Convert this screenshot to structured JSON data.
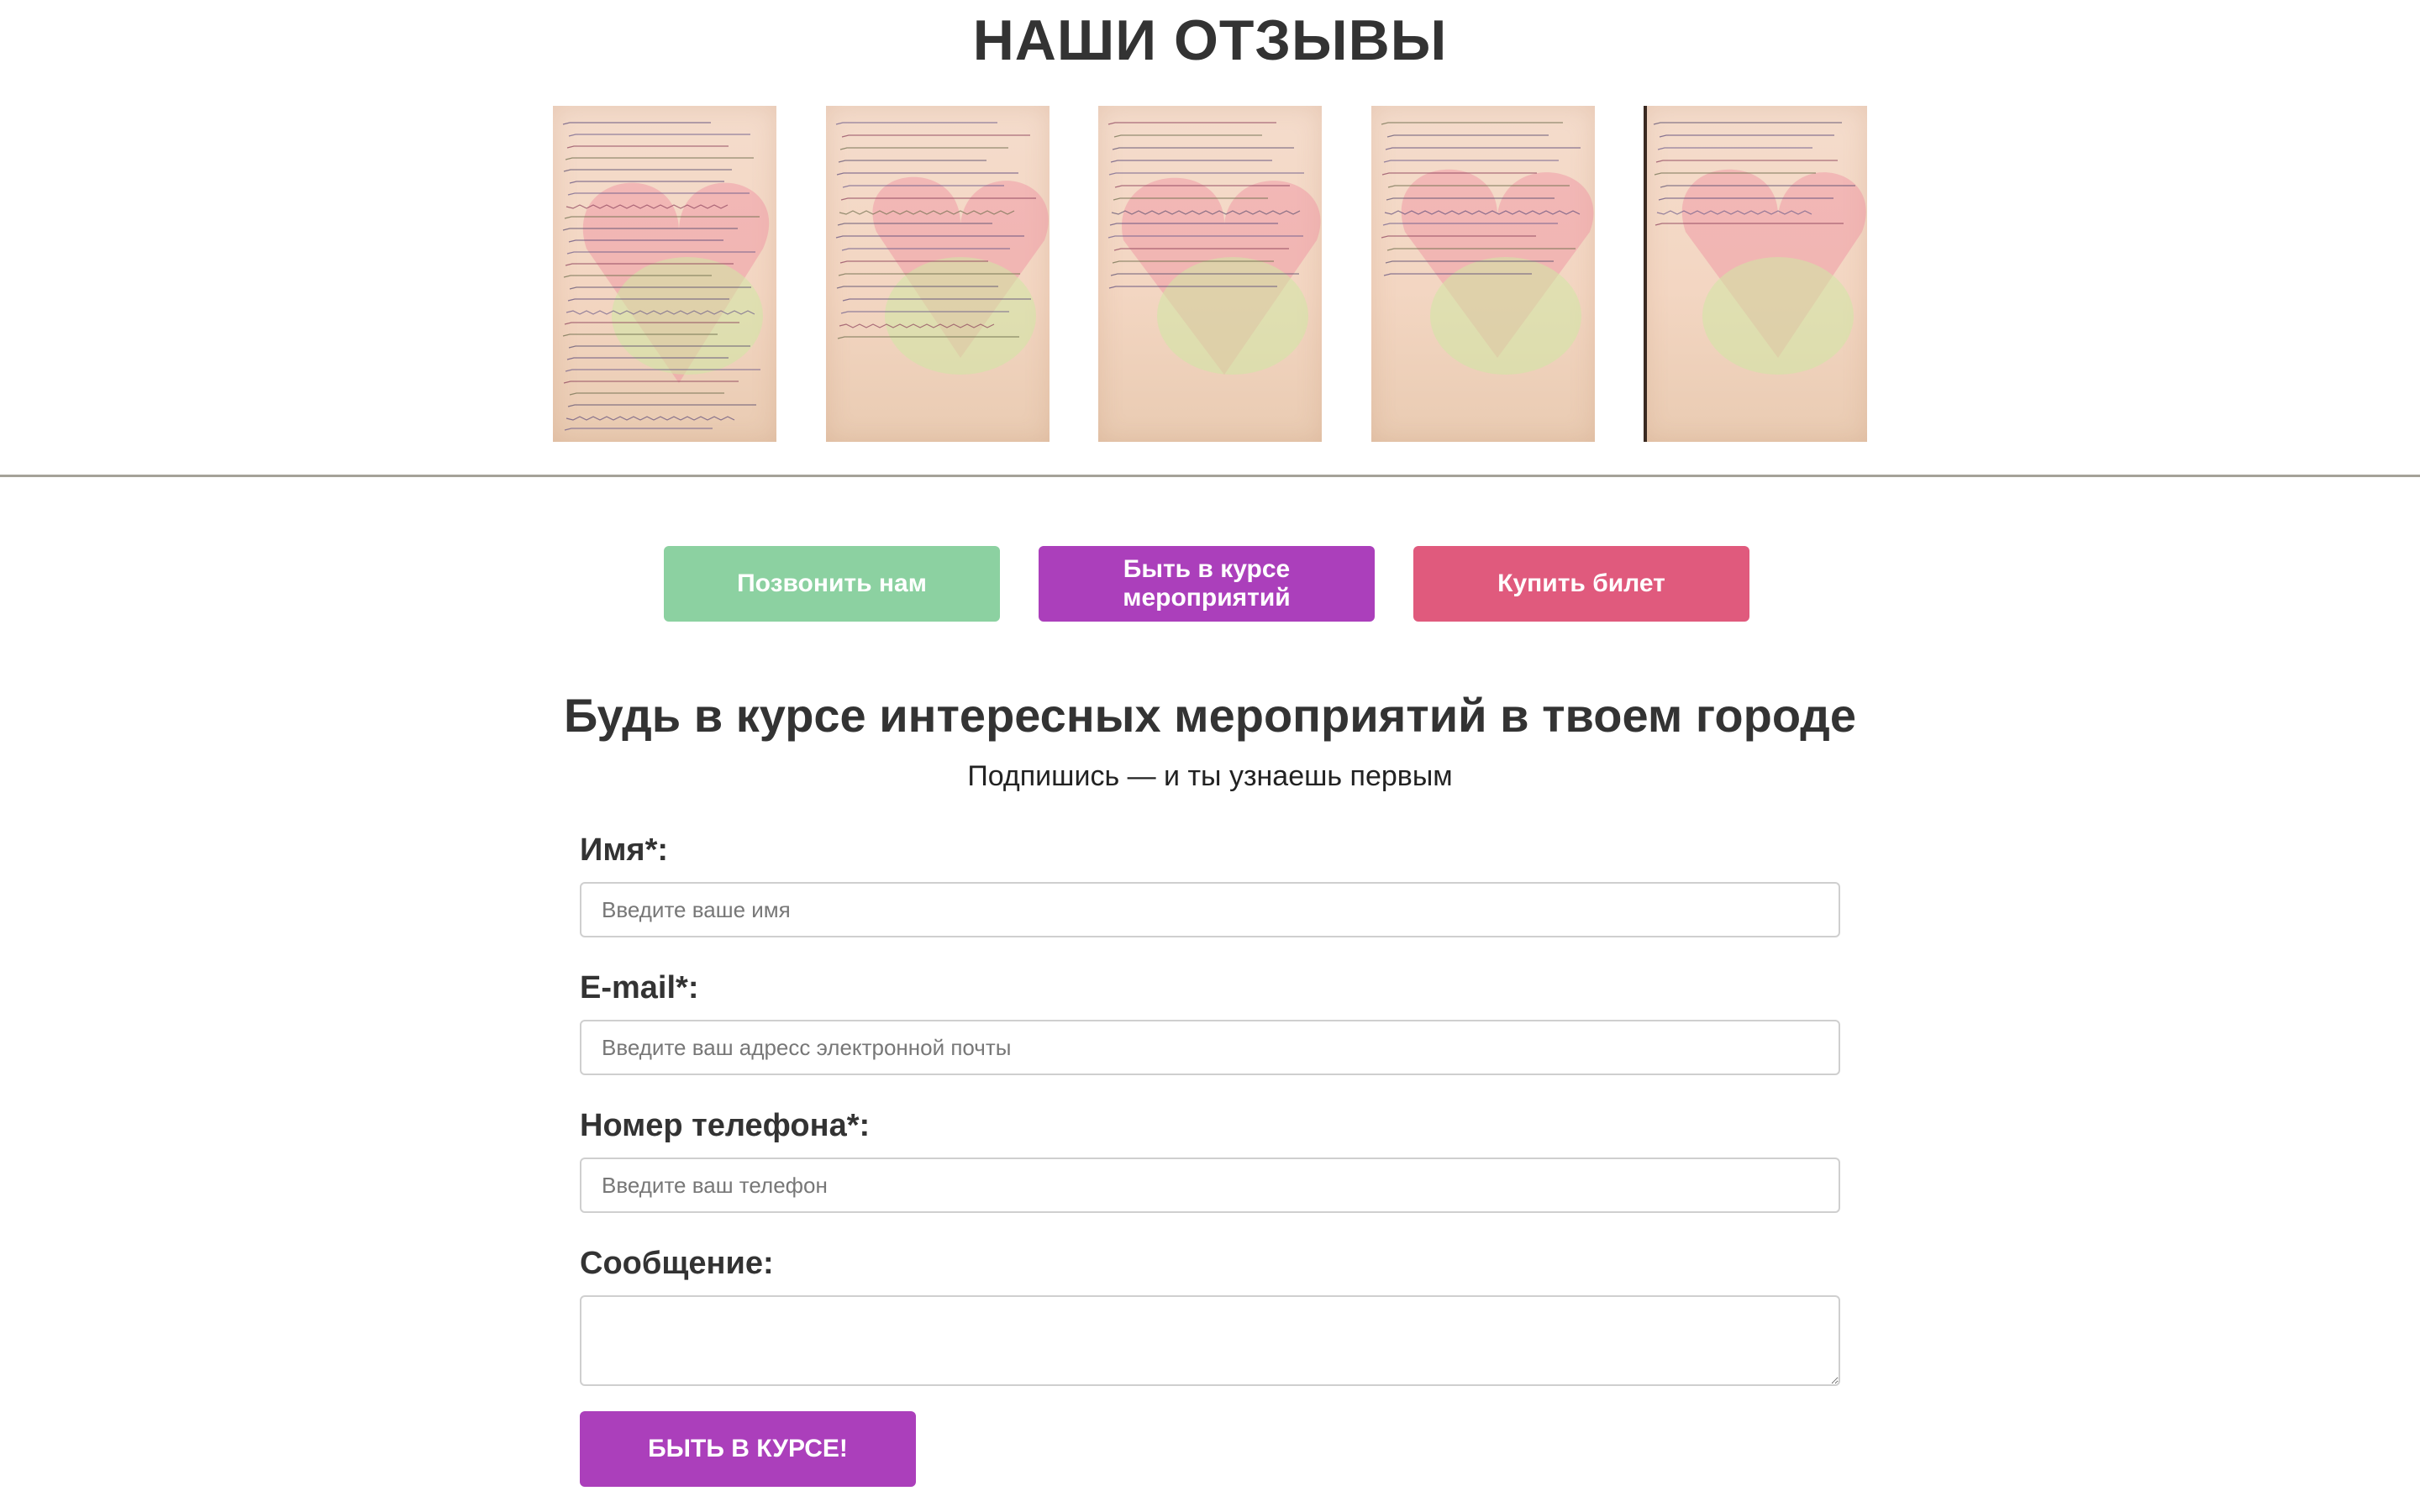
{
  "reviews": {
    "title": "НАШИ ОТЗЫВЫ",
    "images": [
      {
        "alt": "review-photo-1"
      },
      {
        "alt": "review-photo-2"
      },
      {
        "alt": "review-photo-3"
      },
      {
        "alt": "review-photo-4"
      },
      {
        "alt": "review-photo-5"
      }
    ]
  },
  "cta": {
    "call_label": "Позвонить нам",
    "events_label": "Быть в курсе мероприятий",
    "ticket_label": "Купить билет"
  },
  "form": {
    "title": "Будь в курсе интересных мероприятий в твоем городе",
    "subtitle": "Подпишись — и ты узнаешь первым",
    "name_label": "Имя*:",
    "name_placeholder": "Введите ваше имя",
    "email_label": "E-mail*:",
    "email_placeholder": "Введите ваш адресс электронной почты",
    "phone_label": "Номер телефона*:",
    "phone_placeholder": "Введите ваш телефон",
    "message_label": "Сообщение:",
    "submit_label": "БЫТЬ В КУРСЕ!"
  },
  "colors": {
    "call_button": "#8cd1a1",
    "events_button": "#ab3fbb",
    "ticket_button": "#e05a7d",
    "submit_button": "#ab3fbb",
    "divider": "#a5a298"
  }
}
